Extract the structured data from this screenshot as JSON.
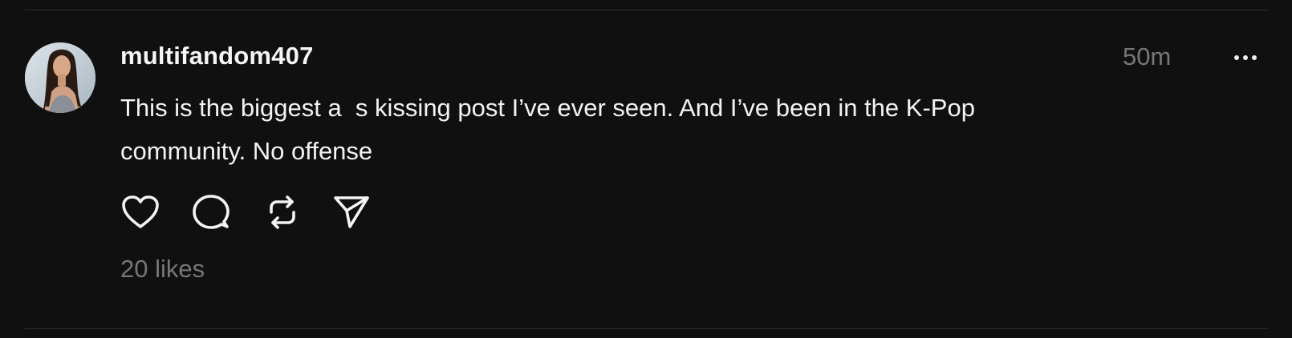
{
  "post": {
    "username": "multifandom407",
    "timestamp": "50m",
    "text": "This is the biggest a  s kissing post I’ve ever seen. And I’ve been in the K-Pop\ncommunity. No offense",
    "likes_label": "20 likes"
  },
  "icons": {
    "avatar": "profile-photo",
    "more": "more-horizontal-icon",
    "like": "heart-icon",
    "reply": "comment-bubble-icon",
    "repost": "repost-arrows-icon",
    "share": "send-icon"
  },
  "colors": {
    "background": "#101010",
    "text": "#f3f3f3",
    "muted": "#777777",
    "divider": "#2f2f2f"
  }
}
